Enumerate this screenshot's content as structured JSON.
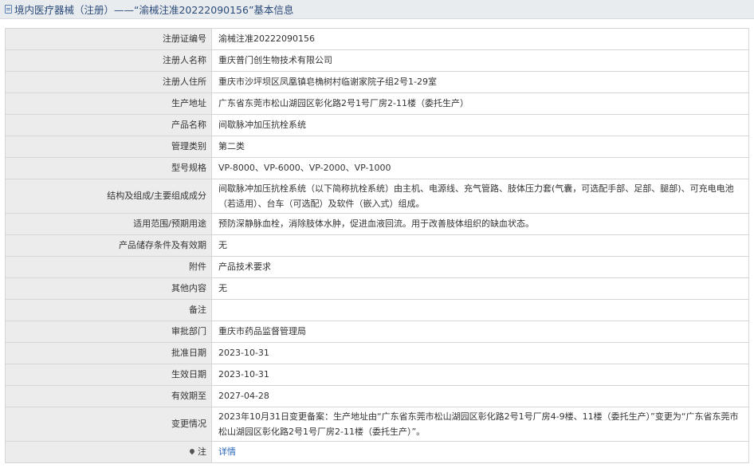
{
  "header": {
    "title": "境内医疗器械（注册）——“渝械注准20222090156”基本信息"
  },
  "rows": [
    {
      "label": "注册证编号",
      "value": "渝械注准20222090156"
    },
    {
      "label": "注册人名称",
      "value": "重庆普门创生物技术有限公司"
    },
    {
      "label": "注册人住所",
      "value": "重庆市沙坪坝区凤凰镇皂桷树村临谢家院子组2号1-29室"
    },
    {
      "label": "生产地址",
      "value": "广东省东莞市松山湖园区彰化路2号1号厂房2-11楼（委托生产）"
    },
    {
      "label": "产品名称",
      "value": "间歇脉冲加压抗栓系统"
    },
    {
      "label": "管理类别",
      "value": "第二类"
    },
    {
      "label": "型号规格",
      "value": "VP-8000、VP-6000、VP-2000、VP-1000"
    },
    {
      "label": "结构及组成/主要组成成分",
      "value": "间歇脉冲加压抗栓系统（以下简称抗栓系统）由主机、电源线、充气管路、肢体压力套(气囊，可选配手部、足部、腿部)、可充电电池（若适用）、台车（可选配）及软件（嵌入式）组成。"
    },
    {
      "label": "适用范围/预期用途",
      "value": "预防深静脉血栓，消除肢体水肿，促进血液回流。用于改善肢体组织的缺血状态。"
    },
    {
      "label": "产品储存条件及有效期",
      "value": "无"
    },
    {
      "label": "附件",
      "value": "产品技术要求"
    },
    {
      "label": "其他内容",
      "value": "无"
    },
    {
      "label": "备注",
      "value": ""
    },
    {
      "label": "审批部门",
      "value": "重庆市药品监督管理局"
    },
    {
      "label": "批准日期",
      "value": "2023-10-31"
    },
    {
      "label": "生效日期",
      "value": "2023-10-31"
    },
    {
      "label": "有效期至",
      "value": "2027-04-28"
    },
    {
      "label": "变更情况",
      "value": "2023年10月31日变更备案：生产地址由“广东省东莞市松山湖园区彰化路2号1号厂房4-9楼、11楼（委托生产）”变更为“广东省东莞市松山湖园区彰化路2号1号厂房2-11楼（委托生产）”。"
    }
  ],
  "note": {
    "label": "注",
    "link": "详情",
    "icon": "pin-icon"
  }
}
